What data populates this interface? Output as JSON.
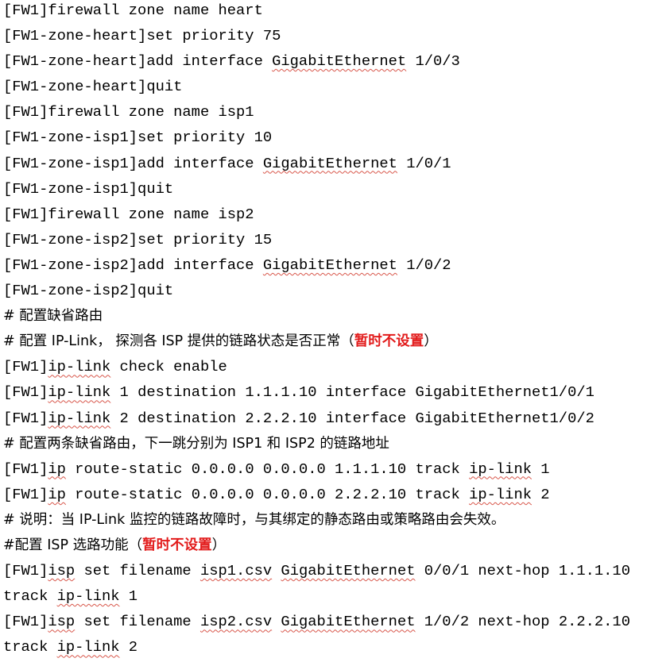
{
  "lines": [
    [
      {
        "t": "[FW1]firewall zone name heart"
      }
    ],
    [
      {
        "t": "[FW1-zone-heart]set priority 75"
      }
    ],
    [
      {
        "t": "[FW1-zone-heart]add interface "
      },
      {
        "t": "GigabitEthernet",
        "s": "wavy"
      },
      {
        "t": " 1/0/3"
      }
    ],
    [
      {
        "t": "[FW1-zone-heart]quit"
      }
    ],
    [
      {
        "t": "[FW1]firewall zone name isp1"
      }
    ],
    [
      {
        "t": "[FW1-zone-isp1]set priority 10"
      }
    ],
    [
      {
        "t": "[FW1-zone-isp1]add interface "
      },
      {
        "t": "GigabitEthernet",
        "s": "wavy"
      },
      {
        "t": " 1/0/1"
      }
    ],
    [
      {
        "t": "[FW1-zone-isp1]quit"
      }
    ],
    [
      {
        "t": "[FW1]firewall zone name isp2"
      }
    ],
    [
      {
        "t": "[FW1-zone-isp2]set priority 15"
      }
    ],
    [
      {
        "t": "[FW1-zone-isp2]add interface "
      },
      {
        "t": "GigabitEthernet",
        "s": "wavy"
      },
      {
        "t": " 1/0/2"
      }
    ],
    [
      {
        "t": "[FW1-zone-isp2]quit"
      }
    ],
    {
      "comment": true,
      "runs": [
        {
          "t": "# 配置缺省路由"
        }
      ]
    },
    {
      "comment": true,
      "runs": [
        {
          "t": "# 配置 IP-Link， 探测各 ISP 提供的链路状态是否正常（"
        },
        {
          "t": "暂时不设置",
          "s": "red"
        },
        {
          "t": "）"
        }
      ]
    },
    [
      {
        "t": "[FW1]"
      },
      {
        "t": "ip-link",
        "s": "wavy"
      },
      {
        "t": " check enable"
      }
    ],
    [
      {
        "t": "[FW1]"
      },
      {
        "t": "ip-link",
        "s": "wavy"
      },
      {
        "t": " 1 destination 1.1.1.10 interface GigabitEthernet1/0/1"
      }
    ],
    [
      {
        "t": "[FW1]"
      },
      {
        "t": "ip-link",
        "s": "wavy"
      },
      {
        "t": " 2 destination 2.2.2.10 interface GigabitEthernet1/0/2"
      }
    ],
    {
      "comment": true,
      "runs": [
        {
          "t": "# 配置两条缺省路由，下一跳分别为 ISP1 和 ISP2 的链路地址"
        }
      ]
    },
    [
      {
        "t": "[FW1]"
      },
      {
        "t": "ip",
        "s": "wavy"
      },
      {
        "t": " route-static 0.0.0.0 0.0.0.0 1.1.1.10 track "
      },
      {
        "t": "ip-link",
        "s": "wavy"
      },
      {
        "t": " 1"
      }
    ],
    [
      {
        "t": "[FW1]"
      },
      {
        "t": "ip",
        "s": "wavy"
      },
      {
        "t": " route-static 0.0.0.0 0.0.0.0 2.2.2.10 track "
      },
      {
        "t": "ip-link",
        "s": "wavy"
      },
      {
        "t": " 2"
      }
    ],
    {
      "comment": true,
      "runs": [
        {
          "t": "# 说明：当 IP-Link 监控的链路故障时，与其绑定的静态路由或策略路由会失效。"
        }
      ]
    },
    {
      "comment": true,
      "runs": [
        {
          "t": "#配置 ISP 选路功能（"
        },
        {
          "t": "暂时不设置",
          "s": "red"
        },
        {
          "t": "）"
        }
      ]
    },
    [
      {
        "t": "[FW1]"
      },
      {
        "t": "isp",
        "s": "wavy"
      },
      {
        "t": " set filename "
      },
      {
        "t": "isp1.csv",
        "s": "wavy"
      },
      {
        "t": " "
      },
      {
        "t": "GigabitEthernet",
        "s": "wavy"
      },
      {
        "t": " 0/0/1 next-hop 1.1.1.10"
      }
    ],
    [
      {
        "t": "track "
      },
      {
        "t": "ip-link",
        "s": "wavy"
      },
      {
        "t": " 1"
      }
    ],
    [
      {
        "t": "[FW1]"
      },
      {
        "t": "isp",
        "s": "wavy"
      },
      {
        "t": " set filename "
      },
      {
        "t": "isp2.csv",
        "s": "wavy"
      },
      {
        "t": " "
      },
      {
        "t": "GigabitEthernet",
        "s": "wavy"
      },
      {
        "t": " 1/0/2 next-hop 2.2.2.10"
      }
    ],
    [
      {
        "t": "track "
      },
      {
        "t": "ip-link",
        "s": "wavy"
      },
      {
        "t": " 2"
      }
    ]
  ]
}
